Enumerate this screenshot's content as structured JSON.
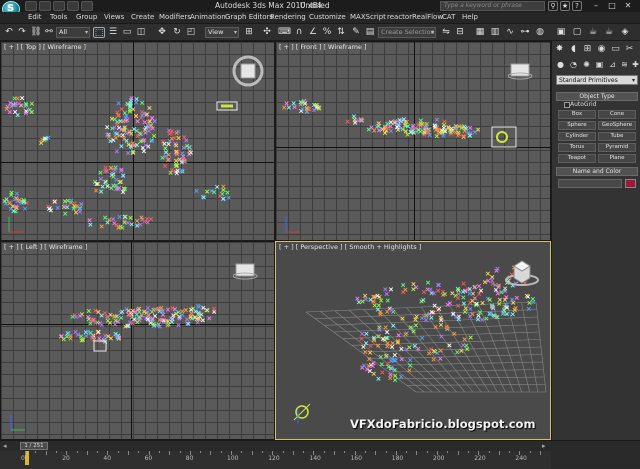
{
  "window": {
    "title": "Autodesk 3ds Max 2010 x64",
    "document": "Untitled",
    "search_placeholder": "Type a keyword or phrase"
  },
  "menu": [
    "Edit",
    "Tools",
    "Group",
    "Views",
    "Create",
    "Modifiers",
    "Animation",
    "Graph Editors",
    "Rendering",
    "Customize",
    "MAXScript",
    "reactor",
    "RealFlow",
    "CAT",
    "Help"
  ],
  "toolbar": {
    "selection_filter": "All",
    "reference_coord": "View",
    "named_selection_placeholder": "Create Selection"
  },
  "viewports": {
    "top": "[ + ] [ Top ] [ Wireframe ]",
    "front": "[ + ] [ Front ] [ Wireframe ]",
    "left": "[ + ] [ Left ] [ Wireframe ]",
    "perspective": "[ + ] [ Perspective ] [ Smooth + Highlights ]"
  },
  "command_panel": {
    "category": "Standard Primitives",
    "object_type_title": "Object Type",
    "autogrid": "AutoGrid",
    "buttons": [
      "Box",
      "Cone",
      "Sphere",
      "GeoSphere",
      "Cylinder",
      "Tube",
      "Torus",
      "Pyramid",
      "Teapot",
      "Plane"
    ],
    "name_color_title": "Name and Color",
    "color": "#a0173a"
  },
  "timeline": {
    "frame": "1 / 251",
    "ticks": [
      "0",
      "20",
      "40",
      "60",
      "80",
      "100",
      "120",
      "140",
      "160",
      "180",
      "200",
      "220",
      "240"
    ]
  },
  "watermark": "VFXdoFabricio.blogspot.com",
  "colors": {
    "viewport_bg": "#5a5a5a",
    "grid_line": "#3d3d3d",
    "active_viewport_border": "#d8c060",
    "ui_bg": "#2b2b2b"
  },
  "icons": [
    "app-logo-icon",
    "undo-icon",
    "redo-icon",
    "link-icon",
    "unlink-icon",
    "bind-icon",
    "select-icon",
    "select-by-name-icon",
    "rect-region-icon",
    "move-icon",
    "rotate-icon",
    "scale-icon",
    "pivot-icon",
    "snap-icon",
    "mirror-icon",
    "align-icon",
    "material-editor-icon",
    "render-icon",
    "teapot-render-icon",
    "create-tab-icon",
    "modify-tab-icon",
    "hierarchy-tab-icon",
    "motion-tab-icon",
    "display-tab-icon",
    "utilities-tab-icon"
  ]
}
